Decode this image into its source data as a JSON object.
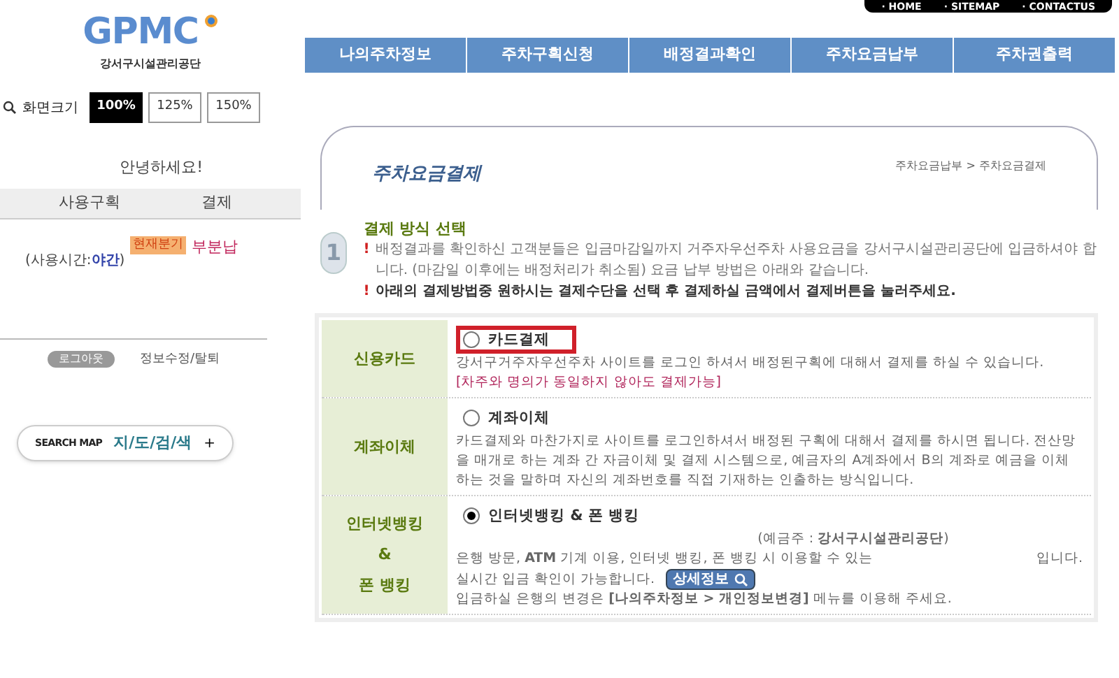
{
  "top_links": [
    "· HOME",
    "· SITEMAP",
    "· CONTACTUS"
  ],
  "logo": {
    "text": "GPMC",
    "org": "강서구시설관리공단"
  },
  "zoom": {
    "label": "화면크기",
    "options": [
      {
        "label": "100%",
        "selected": true
      },
      {
        "label": "125%",
        "selected": false
      },
      {
        "label": "150%",
        "selected": false
      }
    ]
  },
  "greeting": "안녕하세요!",
  "usage_table": {
    "columns": [
      "사용구획",
      "결제"
    ],
    "period_prefix": "(사용시간:",
    "period": "야간",
    "period_suffix": ")",
    "badge": "현재분기",
    "status": "부분납"
  },
  "account_links": {
    "logout": "로그아웃",
    "edit": "정보수정/탈퇴"
  },
  "search_map": {
    "label": "SEARCH MAP",
    "title": "지/도/검/색",
    "plus": "+"
  },
  "nav": [
    {
      "label": "나의주차정보",
      "selected": false
    },
    {
      "label": "주차구획신청",
      "selected": false
    },
    {
      "label": "배정결과확인",
      "selected": false
    },
    {
      "label": "주차요금납부",
      "selected": false
    },
    {
      "label": "주차권출력",
      "selected": false
    }
  ],
  "page_title": "주차요금결제",
  "breadcrumb": "주차요금납부 > 주차요금결제",
  "step": {
    "number": "1",
    "title": "결제 방식 선택",
    "notes": [
      {
        "bold": false,
        "mark": "!",
        "text": "배정결과를 확인하신 고객분들은 입금마감일까지 거주자우선주차 사용요금을 강서구시설관리공단에 입금하셔야 합니다. (마감일 이후에는 배정처리가 취소됨) 요금 납부 방법은 아래와 같습니다."
      },
      {
        "bold": true,
        "mark": "!",
        "text": "아래의 결제방법중 원하시는 결제수단을 선택 후 결제하실 금액에서 결제버튼을 눌러주세요."
      }
    ]
  },
  "methods": [
    {
      "label": "신용카드",
      "option": "카드결제",
      "selected": false,
      "highlighted": true,
      "lines": [
        {
          "kind": "text",
          "text": "강서구거주자우선주차 사이트를 로그인 하셔서 배정된구획에 대해서 결제를 하실 수 있습니다."
        },
        {
          "kind": "note",
          "text": "[차주와 명의가 동일하지 않아도 결제가능]"
        }
      ]
    },
    {
      "label": "계좌이체",
      "option": "계좌이체",
      "selected": false,
      "highlighted": false,
      "lines": [
        {
          "kind": "text",
          "text": "카드결제와 마찬가지로 사이트를 로그인하셔서 배정된 구획에 대해서 결제를 하시면 됩니다. 전산망을 매개로 하는 계좌 간 자금이체 및 결제 시스템으로, 예금자의 A계좌에서 B의 계좌로 예금을 이체하는 것을 말하며 자신의 계좌번호를 직접 기재하는 인출하는 방식입니다."
        }
      ]
    },
    {
      "label": "인터넷뱅킹\n&\n폰 뱅킹",
      "option": "인터넷뱅킹 & 폰 뱅킹",
      "selected": true,
      "highlighted": false,
      "lines": [
        {
          "kind": "center",
          "text": "(예금주 : **강서구시설관리공단**)"
        },
        {
          "kind": "split",
          "text": "은행 방문, **ATM** 기계 이용, 인터넷 뱅킹, 폰 뱅킹 시 이용할 수 있는",
          "tail": "입니다."
        },
        {
          "kind": "button",
          "text": "실시간 입금 확인이 가능합니다.",
          "button": "상세정보"
        },
        {
          "kind": "text",
          "text": "입금하실 은행의 변경은 **[나의주차정보 > 개인정보변경]** 메뉴를 이용해 주세요."
        }
      ]
    }
  ]
}
